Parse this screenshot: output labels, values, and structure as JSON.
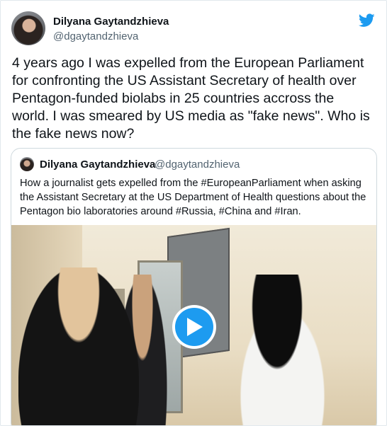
{
  "tweet": {
    "author": {
      "name": "Dilyana Gaytandzhieva",
      "handle": "@dgaytandzhieva"
    },
    "icon": "twitter-bird-icon",
    "accent_color": "#1d9bf0",
    "text": "4 years ago I was expelled from the European Parliament for confronting the US Assistant Secretary of health over Pentagon-funded biolabs in 25 countries accross the world. I was smeared by US media as \"fake news\". Who is the fake news now?"
  },
  "quoted_tweet": {
    "author": {
      "name": "Dilyana Gaytandzhieva",
      "handle": "@dgaytandzhieva"
    },
    "text": "How a journalist gets expelled from the #EuropeanParliament when asking the Assistant Secretary at the US Department of Health questions about the Pentagon bio laboratories around #Russia, #China and #Iran.",
    "media": {
      "type": "video",
      "play_icon": "play-icon"
    }
  }
}
